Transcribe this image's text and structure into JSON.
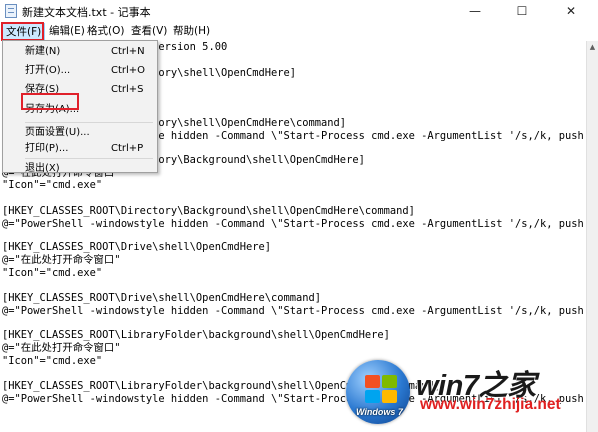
{
  "window": {
    "title": "新建文本文档.txt - 记事本",
    "controls": [
      "—",
      "☐",
      "✕"
    ]
  },
  "menubar": {
    "items": [
      {
        "label": "文件(F)",
        "active": true
      },
      {
        "label": "编辑(E)"
      },
      {
        "label": "格式(O)"
      },
      {
        "label": "查看(V)"
      },
      {
        "label": "帮助(H)"
      }
    ]
  },
  "file_menu": {
    "items": [
      {
        "label": "新建(N)",
        "shortcut": "Ctrl+N"
      },
      {
        "label": "打开(O)...",
        "shortcut": "Ctrl+O"
      },
      {
        "label": "保存(S)",
        "shortcut": "Ctrl+S"
      },
      {
        "label": "另存为(A)...",
        "shortcut": "",
        "highlighted": true
      },
      {
        "label": "页面设置(U)...",
        "shortcut": ""
      },
      {
        "label": "打印(P)...",
        "shortcut": "Ctrl+P"
      },
      {
        "label": "退出(X)",
        "shortcut": ""
      }
    ]
  },
  "editor": {
    "lines": [
      "Windows Registry Editor Version 5.00",
      "",
      "[HKEY_CLASSES_ROOT\\Directory\\shell\\OpenCmdHere]",
      "",
      "",
      "[HKEY_CLASSES_ROOT\\Directory\\shell\\OpenCmdHere\\command]",
      "@=\"PowerShell -windowstyle hidden -Command \\\"Start-Process cmd.exe -ArgumentList '/s,/k, push",
      "",
      "[HKEY_CLASSES_ROOT\\Directory\\Background\\shell\\OpenCmdHere]",
      "@=\"在此处打开命令窗口\"",
      "\"Icon\"=\"cmd.exe\"",
      "",
      "[HKEY_CLASSES_ROOT\\Directory\\Background\\shell\\OpenCmdHere\\command]",
      "@=\"PowerShell -windowstyle hidden -Command \\\"Start-Process cmd.exe -ArgumentList '/s,/k, push",
      "",
      "[HKEY_CLASSES_ROOT\\Drive\\shell\\OpenCmdHere]",
      "@=\"在此处打开命令窗口\"",
      "\"Icon\"=\"cmd.exe\"",
      "",
      "[HKEY_CLASSES_ROOT\\Drive\\shell\\OpenCmdHere\\command]",
      "@=\"PowerShell -windowstyle hidden -Command \\\"Start-Process cmd.exe -ArgumentList '/s,/k, push",
      "",
      "[HKEY_CLASSES_ROOT\\LibraryFolder\\background\\shell\\OpenCmdHere]",
      "@=\"在此处打开命令窗口\"",
      "\"Icon\"=\"cmd.exe\"",
      "",
      "[HKEY_CLASSES_ROOT\\LibraryFolder\\background\\shell\\OpenCmdHere\\command]",
      "@=\"PowerShell -windowstyle hidden -Command \\\"Start-Process cmd.exe -ArgumentList '/s,/k, push"
    ]
  },
  "watermark": {
    "title": "win7之家",
    "url": "www.win7zhijia.net",
    "badge": "Windows 7"
  },
  "colors": {
    "highlight_box": "#e0202a",
    "menu_active_bg": "#cce8ff",
    "url_red": "#e02020"
  }
}
